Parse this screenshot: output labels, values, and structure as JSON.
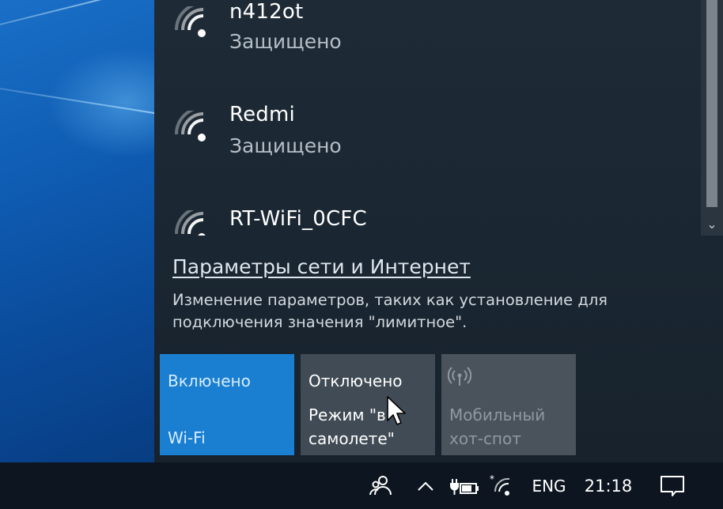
{
  "networks": [
    {
      "name": "n412ot",
      "status": "Защищено"
    },
    {
      "name": "Redmi",
      "status": "Защищено"
    },
    {
      "name": "RT-WiFi_0CFC",
      "status": ""
    }
  ],
  "settings": {
    "link": "Параметры сети и Интернет",
    "description": "Изменение параметров, таких как установление для подключения значения \"лимитное\"."
  },
  "tiles": {
    "wifi": {
      "state": "Включено",
      "label": "Wi-Fi"
    },
    "airplane": {
      "state": "Отключено",
      "label_line1": "Режим \"в",
      "label_line2": "самолете\""
    },
    "hotspot": {
      "label_line1": "Мобильный",
      "label_line2": "хот-спот"
    }
  },
  "taskbar": {
    "language": "ENG",
    "time": "21:18"
  },
  "colors": {
    "accent": "#1a7fd1",
    "panel": "#1e2b37",
    "taskbar": "#0d1620"
  },
  "icons": [
    "wifi-icon",
    "hotspot-icon",
    "people-icon",
    "chevron-up-icon",
    "power-plug-icon",
    "wifi-tray-icon",
    "notification-icon",
    "cursor-icon"
  ]
}
